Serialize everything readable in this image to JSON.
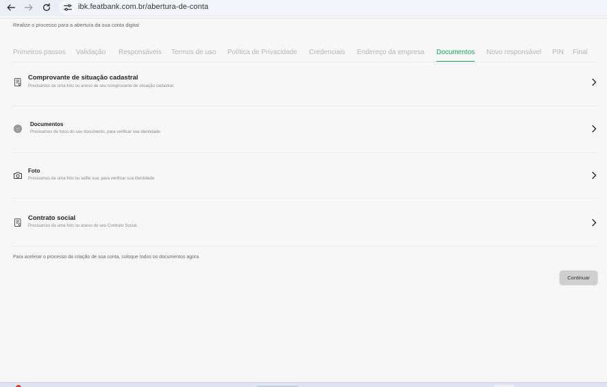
{
  "browser": {
    "url": "ibk.featbank.com.br/abertura-de-conta",
    "back_icon": "arrow-left-icon",
    "forward_icon": "arrow-right-icon",
    "reload_icon": "reload-icon",
    "site_settings_icon": "tune-icon"
  },
  "page": {
    "subtitle": "Realize o processo para a abertura da sua conta digital",
    "footer_note": "Para acelerar o processo da criação de sua conta, coloque todos os documentos agora",
    "continue_label": "Continuar"
  },
  "tabs": [
    {
      "label": "Primeiros passos",
      "active": false
    },
    {
      "label": "Validação",
      "active": false
    },
    {
      "label": "Responsáveis",
      "active": false
    },
    {
      "label": "Termos de uso",
      "active": false
    },
    {
      "label": "Política de Privacidade",
      "active": false
    },
    {
      "label": "Credenciais",
      "active": false
    },
    {
      "label": "Endereço da empresa",
      "active": false
    },
    {
      "label": "Documentos",
      "active": true
    },
    {
      "label": "Novo responsável",
      "active": false
    },
    {
      "label": "PIN",
      "active": false
    },
    {
      "label": "Final",
      "active": false
    }
  ],
  "documents": [
    {
      "title": "Comprovante de situação cadastral",
      "description": "Precisamos de uma foto ou anexo de seu comprovante de situação cadastral.",
      "icon": "document-icon"
    },
    {
      "title": "Documentos",
      "description": "Precisamos de fotos do seu documento, para verificar sua identidade.",
      "icon": "fingerprint-icon"
    },
    {
      "title": "Foto",
      "description": "Precisamos de uma foto ou selfie sua, para verificar sua identidade",
      "icon": "camera-icon"
    },
    {
      "title": "Contrato social",
      "description": "Precisamos de uma foto ou anexo do seu Contrato Social.",
      "icon": "document-icon"
    }
  ],
  "colors": {
    "accent": "#19a65a",
    "inactive_tab": "#b5b5b5",
    "background": "#f7f7f7",
    "button": "#cfcfcf"
  }
}
